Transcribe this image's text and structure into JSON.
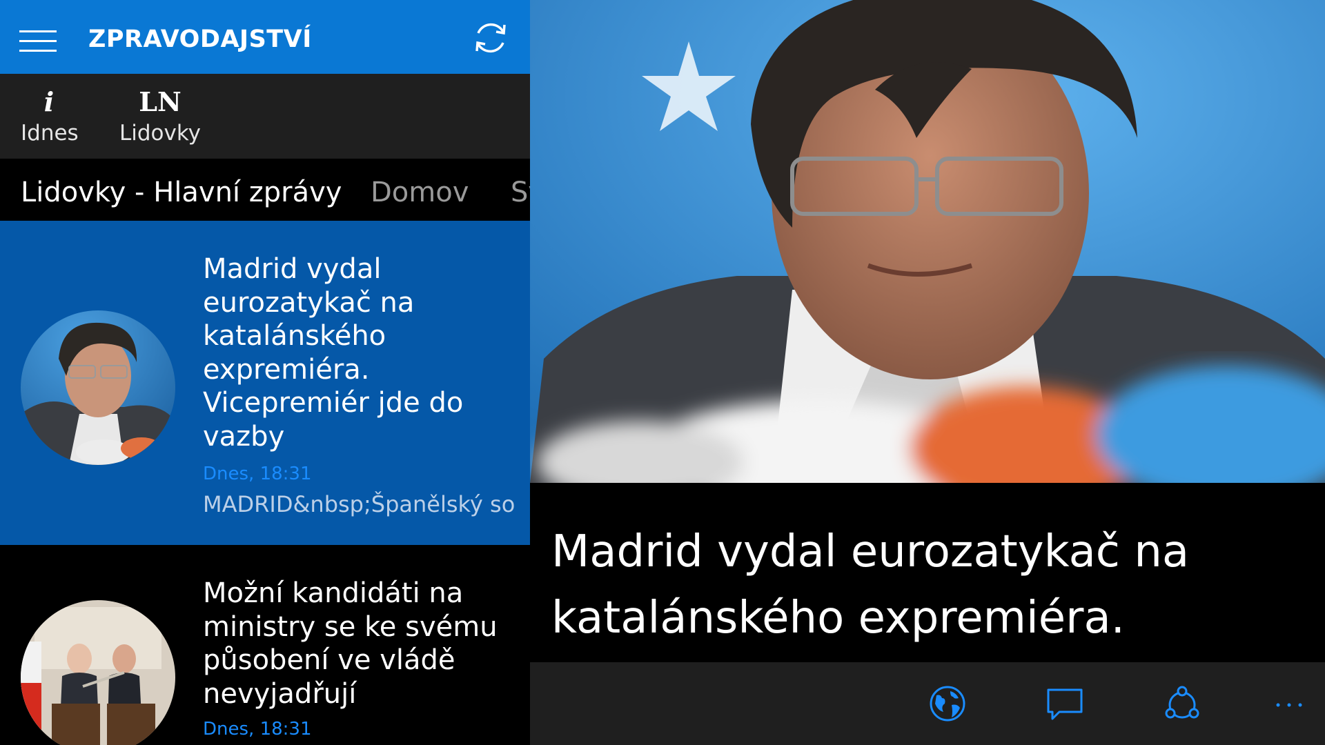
{
  "app": {
    "title": "ZPRAVODAJSTVÍ"
  },
  "sources": [
    {
      "glyph": "i",
      "name": "Idnes"
    },
    {
      "glyph": "LN",
      "name": "Lidovky"
    }
  ],
  "categories": [
    {
      "label": "Lidovky - Hlavní zprávy",
      "selected": true
    },
    {
      "label": "Domov",
      "selected": false
    },
    {
      "label": "Sv",
      "selected": false
    }
  ],
  "articles": [
    {
      "title": "Madrid vydal eurozatykač na katalánského expremiéra. Vicepremiér jde do vazby",
      "time": "Dnes, 18:31",
      "snippet": "MADRID&nbsp;Španělský so",
      "selected": true
    },
    {
      "title": "Možní kandidáti na ministry se ke svému působení ve vládě nevyjadřují",
      "time": "Dnes, 18:31"
    }
  ],
  "detail": {
    "headline": "Madrid vydal eurozatykač na katalánského expremiéra."
  },
  "colors": {
    "accent": "#0a78d4",
    "selected_article_bg": "#0558a8",
    "timestamp": "#1a8cff",
    "panel_bg": "#1f1f1f",
    "icon": "#1a8cff"
  },
  "icons": {
    "menu": "hamburger-icon",
    "refresh": "refresh-icon",
    "web": "globe-icon",
    "comments": "comment-icon",
    "share": "share-icon",
    "more": "more-icon"
  }
}
